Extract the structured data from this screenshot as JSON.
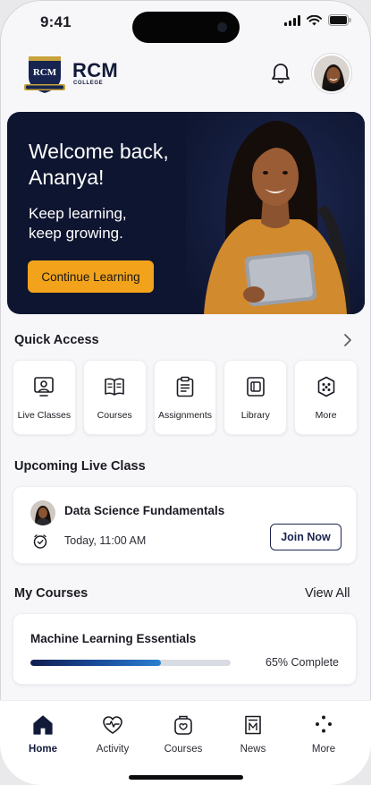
{
  "status_bar": {
    "time": "9:41"
  },
  "header": {
    "logo_crest_text": "RCM",
    "brand": "RCM",
    "brand_sub": "COLLEGE",
    "notification_icon": "bell-icon",
    "profile_icon": "avatar"
  },
  "hero": {
    "title": "Welcome back, Ananya!",
    "subtitle": "Keep learning, keep growing.",
    "cta_label": "Continue Learning",
    "accent_color": "#f2a31b",
    "background_color": "#0e1530"
  },
  "quick_access": {
    "title": "Quick Access",
    "items": [
      {
        "label": "Live Classes",
        "icon": "live-class-icon"
      },
      {
        "label": "Courses",
        "icon": "book-icon"
      },
      {
        "label": "Assignments",
        "icon": "clipboard-icon"
      },
      {
        "label": "Library",
        "icon": "library-icon"
      },
      {
        "label": "More",
        "icon": "more-dots-icon"
      }
    ]
  },
  "upcoming": {
    "title": "Upcoming Live Class",
    "class_name": "Data Science Fundamentals",
    "time": "Today, 11:00 AM",
    "join_label": "Join Now"
  },
  "my_courses": {
    "title": "My Courses",
    "view_all": "View All",
    "course_name": "Machine Learning Essentials",
    "progress": 0.65,
    "progress_text": "65% Complete"
  },
  "bottom_nav": {
    "items": [
      {
        "label": "Home",
        "icon": "home-icon",
        "active": true
      },
      {
        "label": "Activity",
        "icon": "heart-pulse-icon",
        "active": false
      },
      {
        "label": "Courses",
        "icon": "courses-icon",
        "active": false
      },
      {
        "label": "News",
        "icon": "news-icon",
        "active": false
      },
      {
        "label": "More",
        "icon": "more-dots-icon",
        "active": false
      }
    ]
  }
}
